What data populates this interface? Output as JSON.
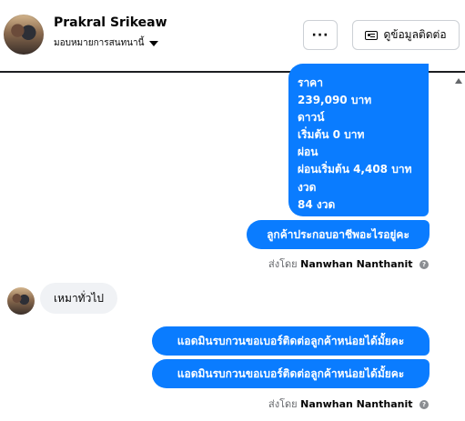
{
  "header": {
    "name": "Prakral Srikeaw",
    "assign_label": "มอบหมายการสนทนานี้",
    "more_label": "···",
    "contact_label": "ดูข้อมูลติดต่อ"
  },
  "chat": {
    "price_block_lines": [
      "ราคา",
      "239,090 บาท",
      "ดาวน์",
      "เริ่มต้น 0 บาท",
      "ผ่อน",
      "ผ่อนเริ่มต้น 4,408 บาท",
      "งวด",
      "84 งวด"
    ],
    "job_question": "ลูกค้าประกอบอาชีพอะไรอยู่คะ",
    "sent_by_prefix": "ส่งโดย",
    "agent_name": "Nanwhan Nanthanit",
    "incoming_reply": "เหมาทั่วไป",
    "admin_request_1": "แอดมินรบกวนขอเบอร์ติดต่อลูกค้าหน่อยได้มั้ยคะ",
    "admin_request_2": "แอดมินรบกวนขอเบอร์ติดต่อลูกค้าหน่อยได้มั้ยคะ",
    "help_glyph": "?"
  },
  "colors": {
    "bubble_blue": "#0a7cff",
    "bubble_gray": "#f0f2f5",
    "header_divider": "#1c1e21"
  },
  "icons": {
    "more": "more-horizontal-icon",
    "contact": "contact-card-icon",
    "assign": "chevron-down-icon",
    "help": "question-circle-icon"
  }
}
